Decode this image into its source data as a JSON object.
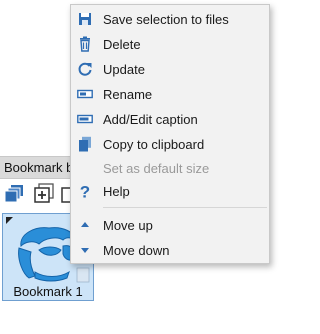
{
  "context_menu": {
    "items": [
      {
        "label": "Save selection to files",
        "icon": "floppy-disk-icon",
        "enabled": true
      },
      {
        "label": "Delete",
        "icon": "trash-icon",
        "enabled": true
      },
      {
        "label": "Update",
        "icon": "refresh-icon",
        "enabled": true
      },
      {
        "label": "Rename",
        "icon": "rename-icon",
        "enabled": true
      },
      {
        "label": "Add/Edit caption",
        "icon": "caption-icon",
        "enabled": true
      },
      {
        "label": "Copy to clipboard",
        "icon": "clipboard-icon",
        "enabled": true
      },
      {
        "label": "Set as default size",
        "icon": "",
        "enabled": false
      },
      {
        "label": "Help",
        "icon": "help-icon",
        "enabled": true
      },
      {
        "label": "Move up",
        "icon": "arrow-up-icon",
        "enabled": true
      },
      {
        "label": "Move down",
        "icon": "arrow-down-icon",
        "enabled": true
      }
    ]
  },
  "bookmark_panel": {
    "header_title": "Bookmark br",
    "bookmarks": [
      {
        "label": "Bookmark 1"
      }
    ]
  },
  "colors": {
    "menu_background": "#f2f2f2",
    "icon_blue": "#2f6db3",
    "disabled_text": "#9a9a9a",
    "selection_background": "#cde4f8",
    "selection_border": "#6f9fd0"
  }
}
